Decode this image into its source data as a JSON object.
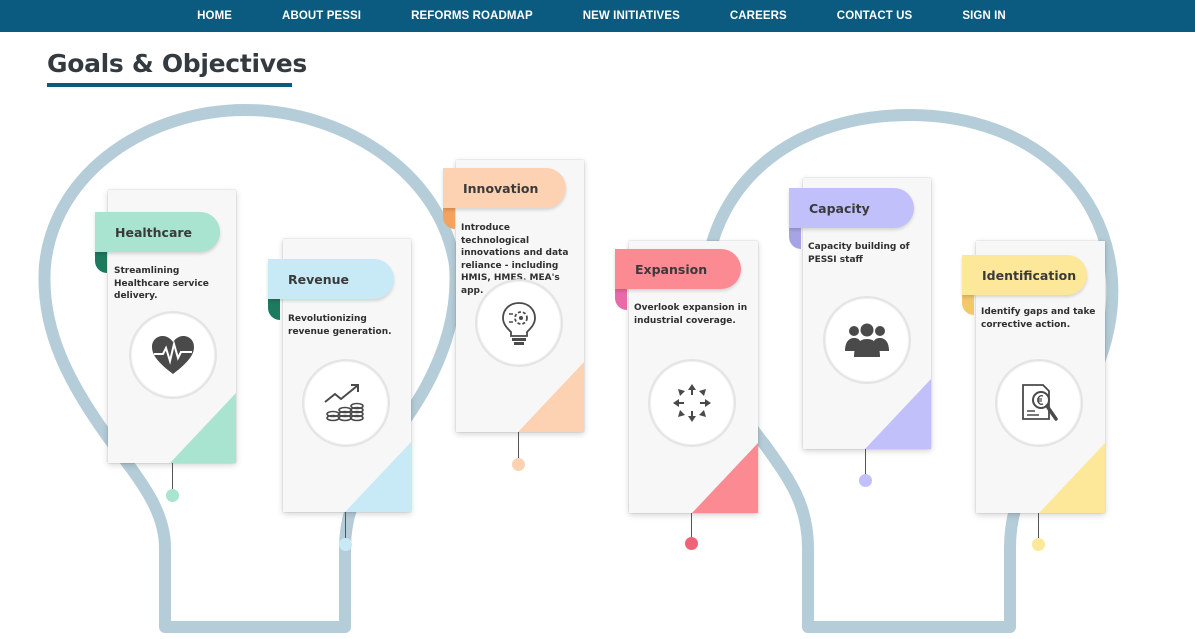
{
  "nav": {
    "items": [
      {
        "label": "HOME"
      },
      {
        "label": "ABOUT PESSI"
      },
      {
        "label": "REFORMS ROADMAP"
      },
      {
        "label": "NEW INITIATIVES"
      },
      {
        "label": "CAREERS"
      },
      {
        "label": "CONTACT US"
      },
      {
        "label": "SIGN IN"
      }
    ]
  },
  "page": {
    "title": "Goals & Objectives"
  },
  "colors": {
    "nav_bg": "#0b5a80",
    "bulb_outline": "#b5cdd8",
    "healthcare": "#a8e4cf",
    "revenue": "#c8eaf7",
    "innovation": "#fdd2b3",
    "expansion": "#fb8a93",
    "capacity": "#c2c0fb",
    "identification": "#fde799"
  },
  "goals": [
    {
      "title": "Healthcare",
      "description": "Streamlining Healthcare service delivery.",
      "icon": "heart-pulse-icon"
    },
    {
      "title": "Revenue",
      "description": "Revolutionizing revenue generation.",
      "icon": "revenue-growth-icon"
    },
    {
      "title": "Innovation",
      "description": "Introduce technological innovations and data reliance - including HMIS, HMES, MEA's app.",
      "icon": "lightbulb-gear-icon"
    },
    {
      "title": "Expansion",
      "description": "Overlook expansion in industrial coverage.",
      "icon": "expand-arrows-icon"
    },
    {
      "title": "Capacity",
      "description": "Capacity building of PESSI staff",
      "icon": "people-group-icon"
    },
    {
      "title": "Identification",
      "description": "Identify gaps and take corrective action.",
      "icon": "document-magnifier-icon"
    }
  ]
}
